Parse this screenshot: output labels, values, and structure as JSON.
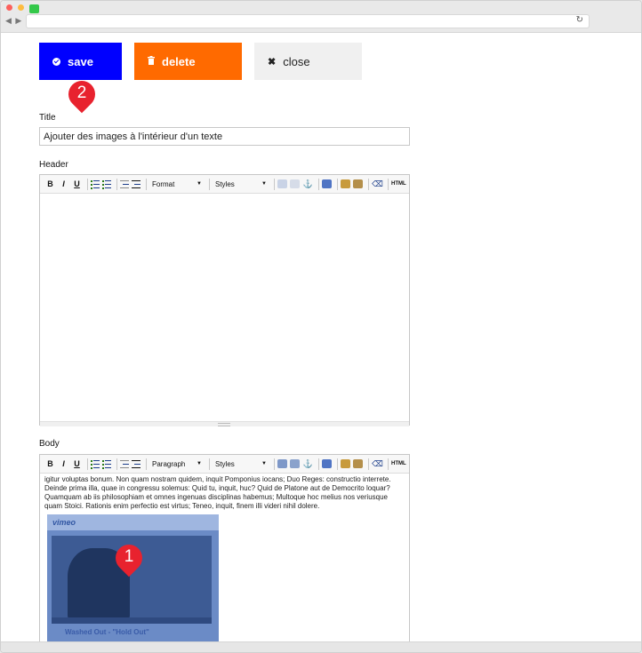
{
  "toolbar": {
    "save_label": "save",
    "delete_label": "delete",
    "close_label": "close"
  },
  "markers": {
    "first": "1",
    "second": "2"
  },
  "form": {
    "title_label": "Title",
    "title_value": "Ajouter des images à l'intérieur d'un texte",
    "header_label": "Header",
    "body_label": "Body"
  },
  "editor_toolbar": {
    "bold": "B",
    "italic": "I",
    "underline": "U",
    "header_format": "Format",
    "body_format": "Paragraph",
    "styles": "Styles",
    "html": "HTML"
  },
  "body": {
    "text": "igitur voluptas bonum. Non quam nostram quidem, inquit Pomponius iocans; Duo Reges: constructio interrete. Deinde prima illa, quae in congressu solemus: Quid tu, inquit, huc? Quid de Platone aut de Democrito loquar? Quamquam ab iis philosophiam et omnes ingenuas disciplinas habemus; Multoque hoc melius nos veriusque quam Stoici. Rationis enim perfectio est virtus; Teneo, inquit, finem illi videri nihil dolere.",
    "video_logo": "vimeo",
    "video_caption": "Washed Out - \"Hold Out\""
  },
  "colors": {
    "save": "#0000ff",
    "delete": "#ff6a00",
    "close": "#f0f0f0",
    "marker": "#e8222e"
  }
}
